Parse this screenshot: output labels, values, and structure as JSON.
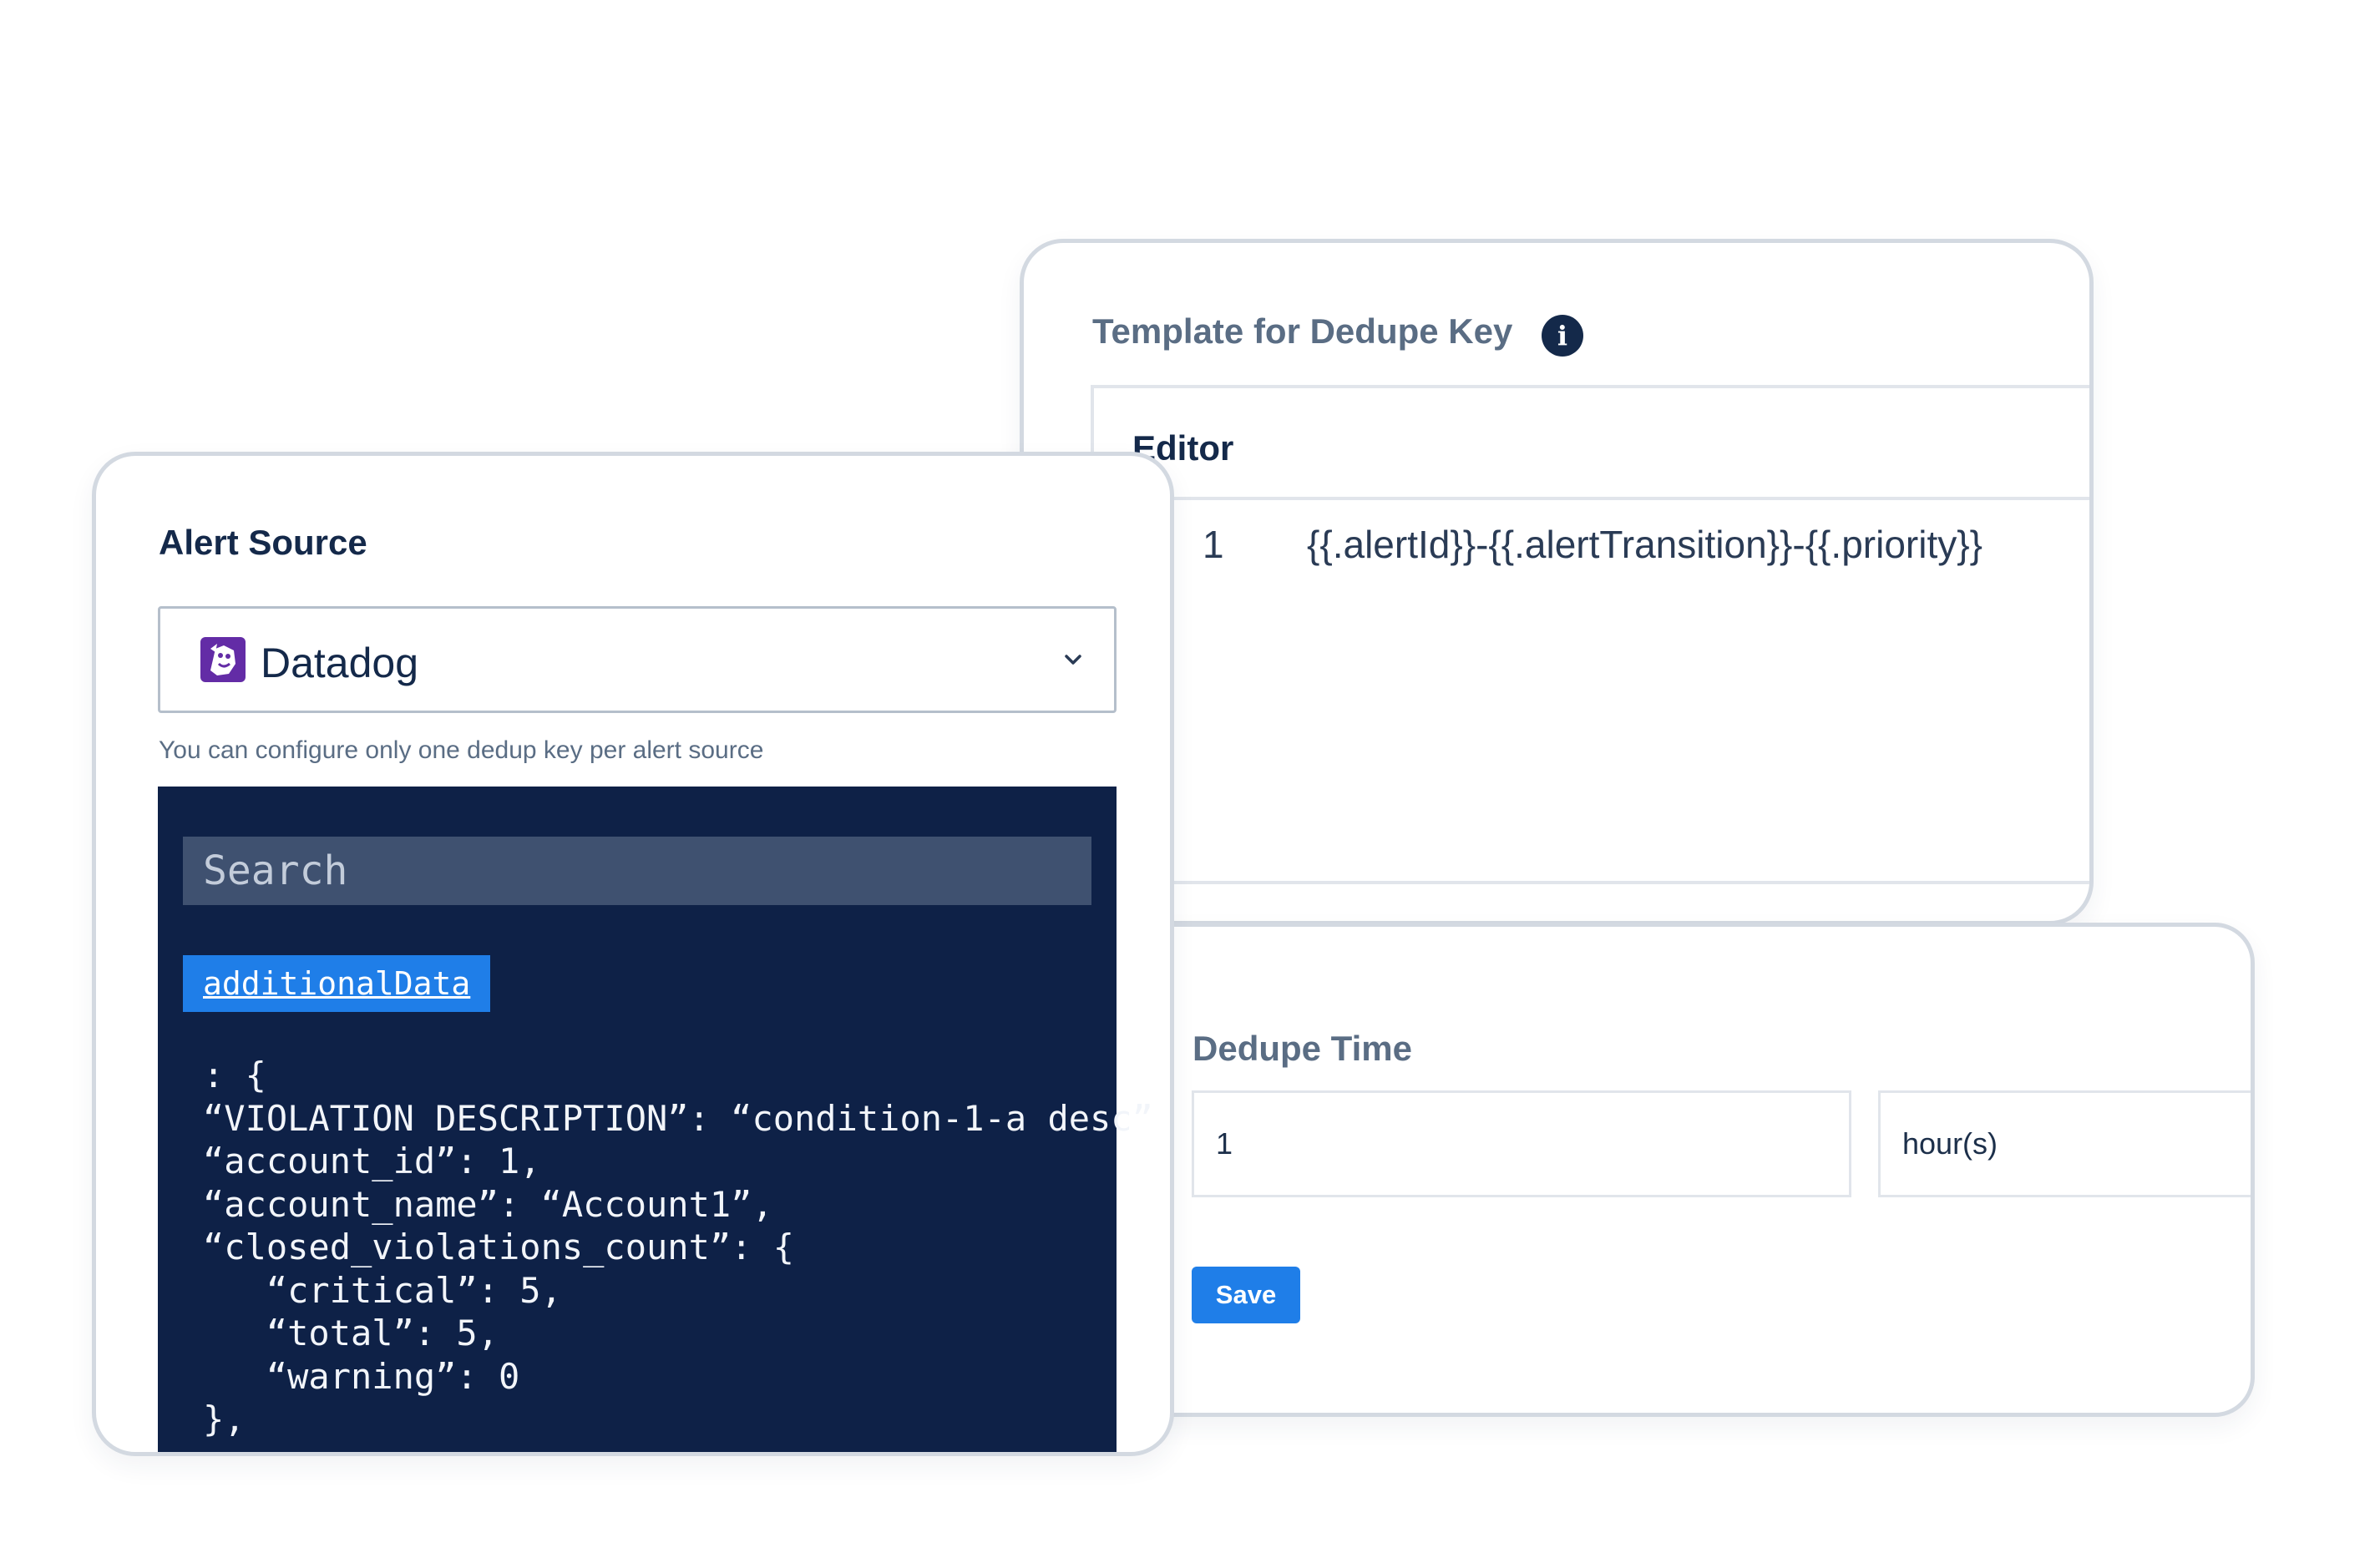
{
  "template_card": {
    "title": "Template for Dedupe Key",
    "info_icon": "info-icon",
    "editor_title": "Editor",
    "line_number": "1",
    "line_code": "{{.alertId}}-{{.alertTransition}}-{{.priority}}"
  },
  "dedupe_card": {
    "title": "Dedupe Time",
    "time_value": "1",
    "unit_value": "hour(s)",
    "save_label": "Save"
  },
  "source_card": {
    "title": "Alert Source",
    "selected_source": "Datadog",
    "source_icon": "datadog-logo-icon",
    "help_text": "You can configure only one dedup key per alert source",
    "search_placeholder": "Search",
    "tag_label": "additionalData",
    "json_lines": [
      ": {",
      "“VIOLATION DESCRIPTION”: “condition-1-a desc”",
      "“account_id”: 1,",
      "“account_name”: “Account1”,",
      "“closed_violations_count”: {",
      "   “critical”: 5,",
      "   “total”: 5,",
      "   “warning”: 0",
      "},"
    ]
  },
  "colors": {
    "accent": "#1f7ee8",
    "navy": "#0e2147",
    "heading": "#14294a",
    "muted": "#5a6d84",
    "card_border": "#d3d9e1"
  }
}
